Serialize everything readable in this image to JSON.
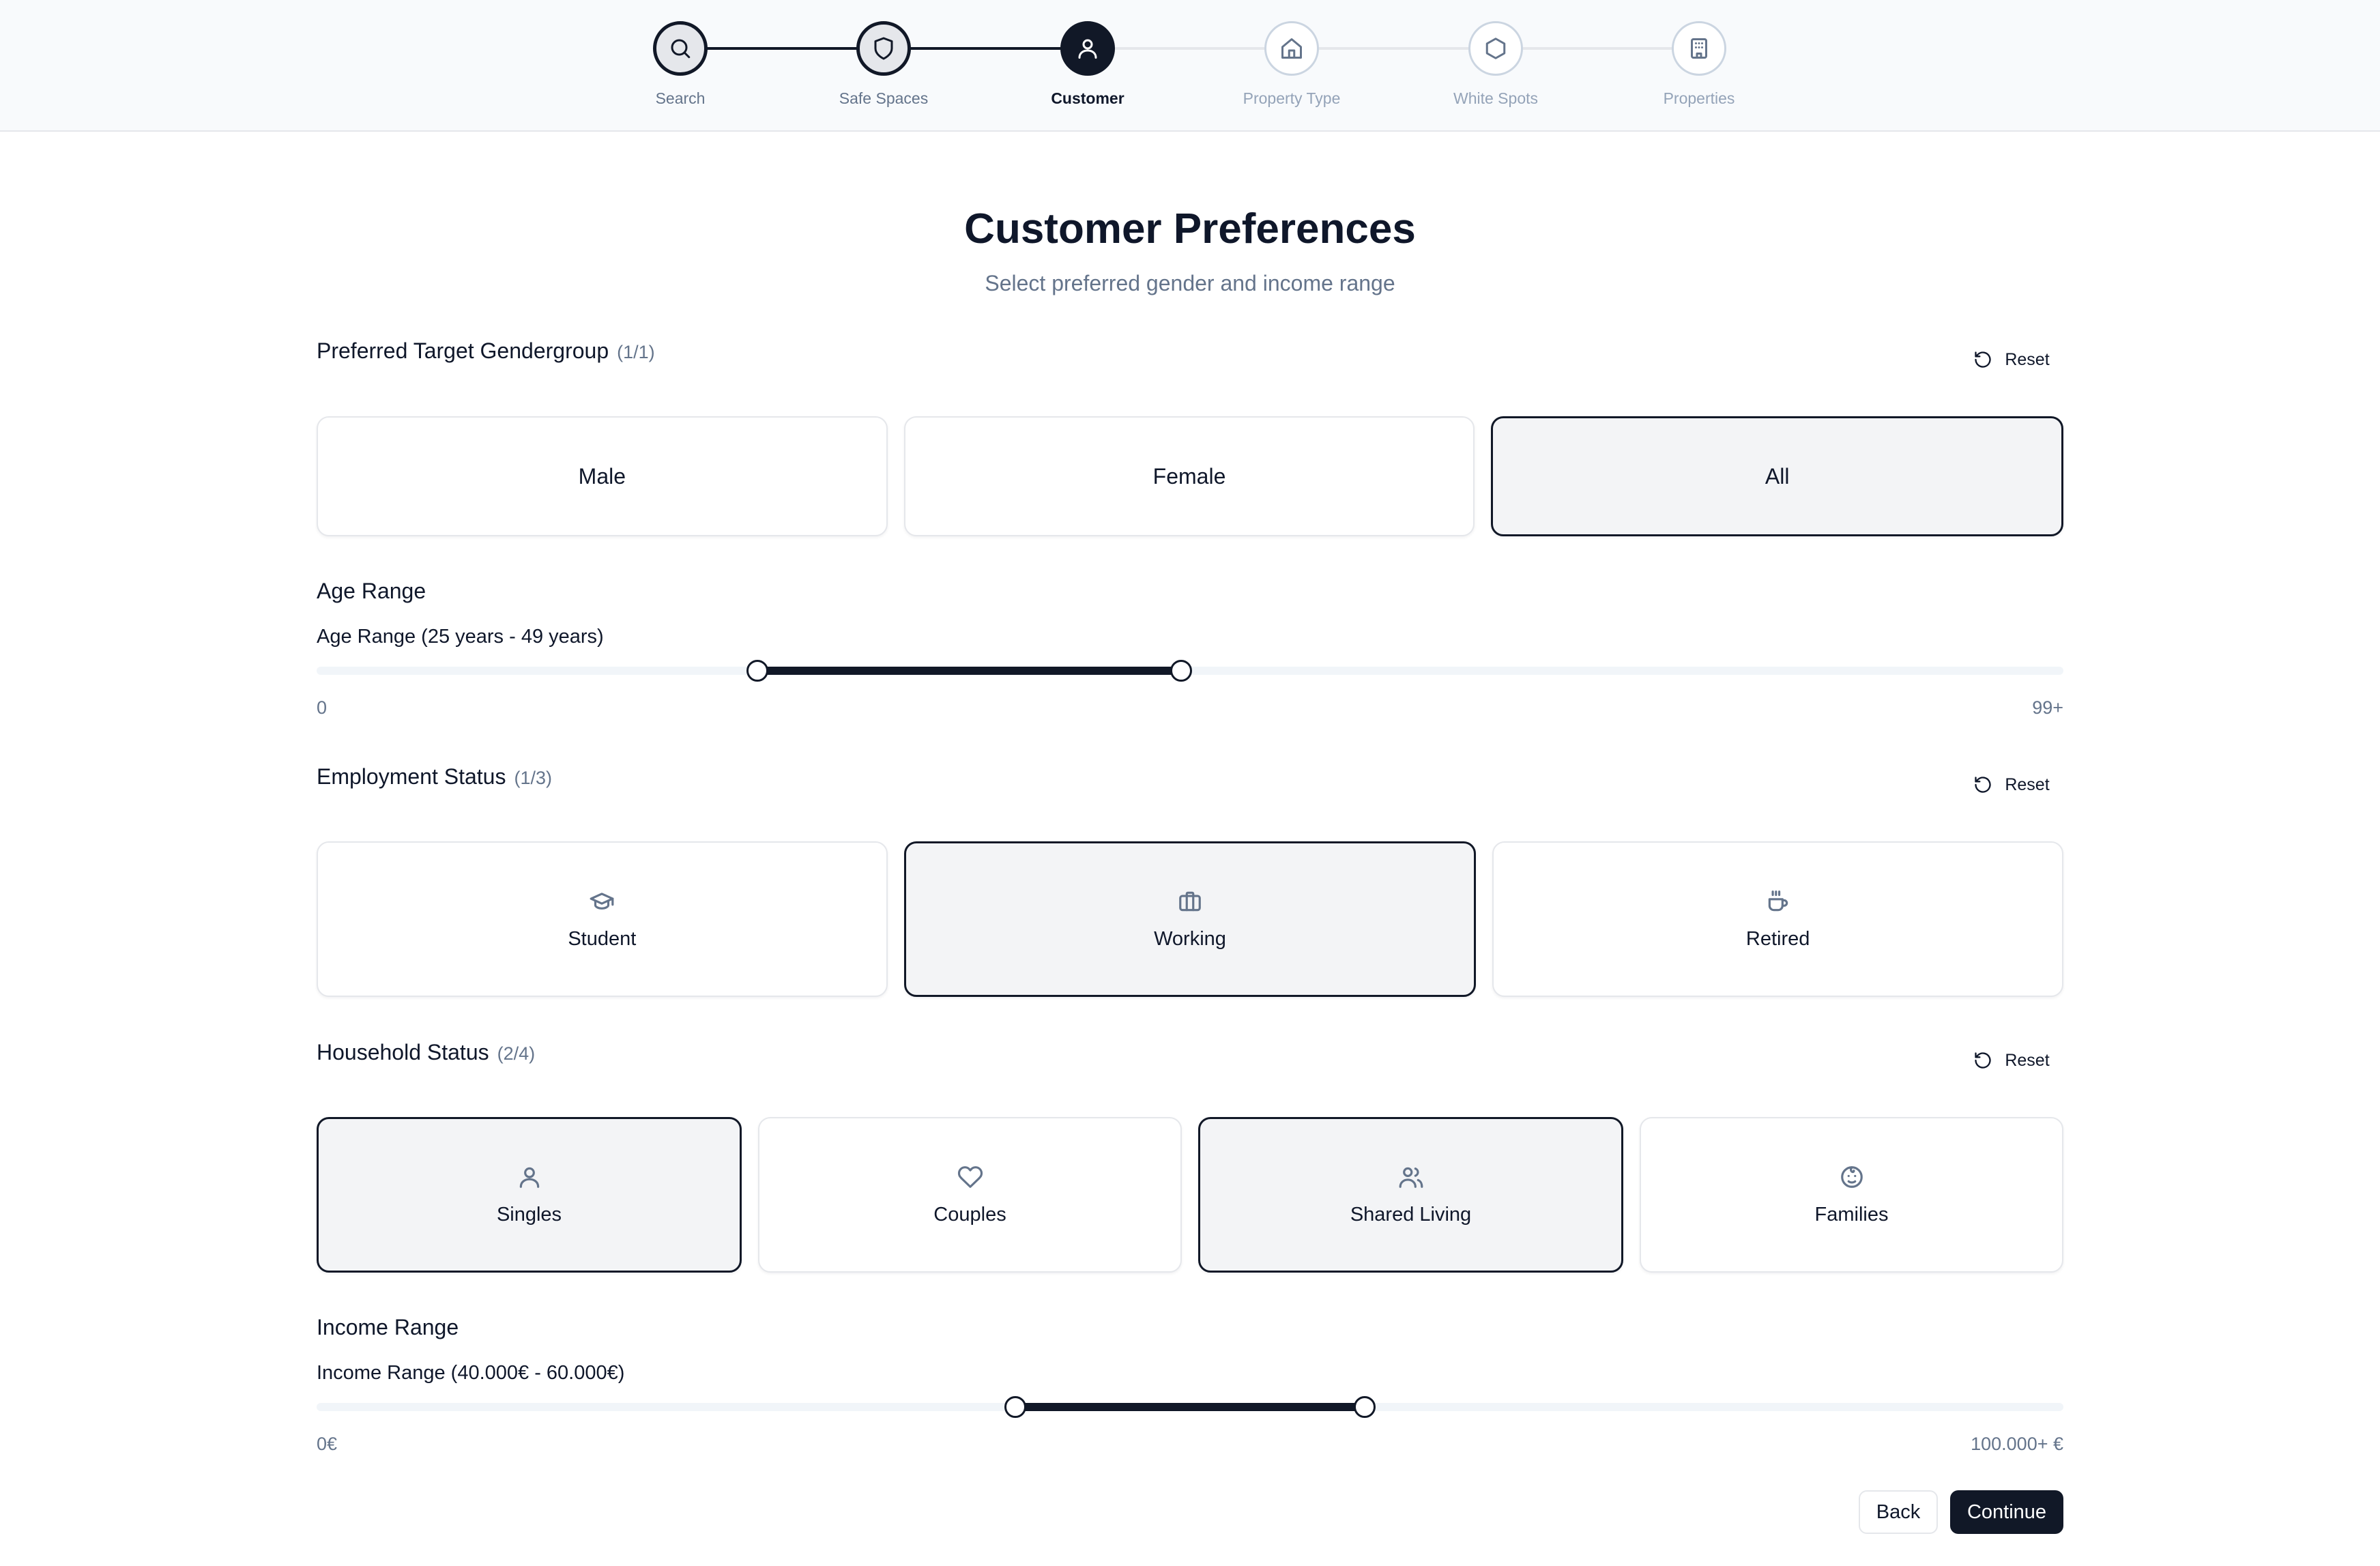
{
  "stepper": {
    "steps": [
      {
        "label": "Search",
        "icon": "search-icon",
        "state": "completed"
      },
      {
        "label": "Safe Spaces",
        "icon": "shield-icon",
        "state": "completed"
      },
      {
        "label": "Customer",
        "icon": "user-icon",
        "state": "active"
      },
      {
        "label": "Property Type",
        "icon": "home-icon",
        "state": "upcoming"
      },
      {
        "label": "White Spots",
        "icon": "hexagon-icon",
        "state": "upcoming"
      },
      {
        "label": "Properties",
        "icon": "building-icon",
        "state": "upcoming"
      }
    ]
  },
  "page": {
    "title": "Customer Preferences",
    "subtitle": "Select preferred gender and income range"
  },
  "gender": {
    "title": "Preferred Target Gendergroup",
    "count": "(1/1)",
    "reset_label": "Reset",
    "options": [
      {
        "label": "Male",
        "selected": false
      },
      {
        "label": "Female",
        "selected": false
      },
      {
        "label": "All",
        "selected": true
      }
    ]
  },
  "age": {
    "heading": "Age Range",
    "value_label": "Age Range (25 years - 49 years)",
    "min_value": 25,
    "max_value": 49,
    "scale_min": 0,
    "scale_max": 99,
    "min_label": "0",
    "max_label": "99+"
  },
  "employment": {
    "title": "Employment Status",
    "count": "(1/3)",
    "reset_label": "Reset",
    "options": [
      {
        "label": "Student",
        "icon": "graduation-cap-icon",
        "selected": false
      },
      {
        "label": "Working",
        "icon": "briefcase-icon",
        "selected": true
      },
      {
        "label": "Retired",
        "icon": "coffee-icon",
        "selected": false
      }
    ]
  },
  "household": {
    "title": "Household Status",
    "count": "(2/4)",
    "reset_label": "Reset",
    "options": [
      {
        "label": "Singles",
        "icon": "user-icon",
        "selected": true
      },
      {
        "label": "Couples",
        "icon": "heart-icon",
        "selected": false
      },
      {
        "label": "Shared Living",
        "icon": "users-icon",
        "selected": true
      },
      {
        "label": "Families",
        "icon": "baby-icon",
        "selected": false
      }
    ]
  },
  "income": {
    "heading": "Income Range",
    "value_label": "Income Range (40.000€ - 60.000€)",
    "min_value": 40000,
    "max_value": 60000,
    "scale_min": 0,
    "scale_max": 100000,
    "min_label": "0€",
    "max_label": "100.000+ €"
  },
  "footer": {
    "back_label": "Back",
    "continue_label": "Continue"
  },
  "colors": {
    "primary": "#111827",
    "muted_text": "#64748b",
    "border": "#e5e7eb",
    "selected_bg": "#f3f4f6"
  }
}
